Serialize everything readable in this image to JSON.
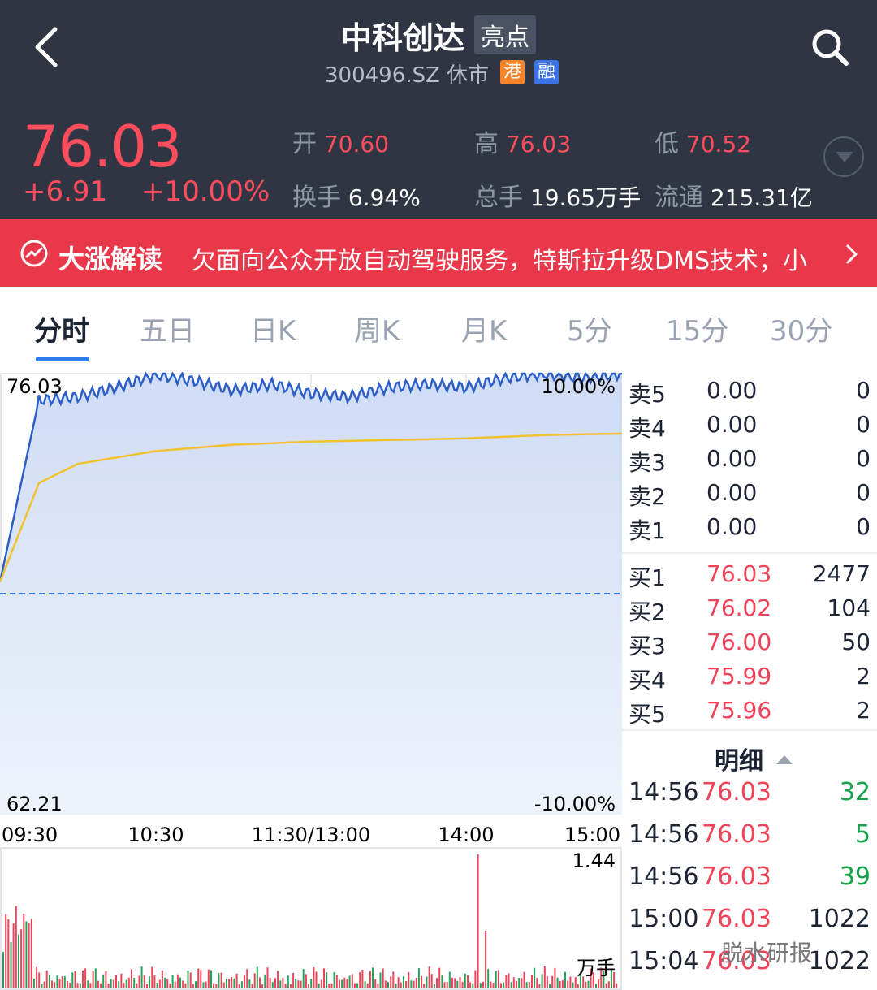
{
  "header": {
    "title": "中科创达",
    "title_tag": "亮点",
    "code_status": "300496.SZ 休市",
    "badge_hk": "港",
    "badge_margin": "融"
  },
  "quote": {
    "price": "76.03",
    "change": "+6.91",
    "change_pct": "+10.00%",
    "open_label": "开",
    "open": "70.60",
    "high_label": "高",
    "high": "76.03",
    "low_label": "低",
    "low": "70.52",
    "turnover_label": "换手",
    "turnover": "6.94%",
    "volume_label": "总手",
    "volume": "19.65万手",
    "float_label": "流通",
    "float_cap": "215.31亿"
  },
  "banner": {
    "label": "大涨解读",
    "text": "欠面向公众开放自动驾驶服务，特斯拉升级DMS技术；小"
  },
  "tabs": [
    "分时",
    "五日",
    "日K",
    "周K",
    "月K",
    "5分",
    "15分",
    "30分"
  ],
  "chart": {
    "price_top": "76.03",
    "price_bottom": "62.21",
    "pct_top": "10.00%",
    "pct_bottom": "-10.00%",
    "times": [
      "09:30",
      "10:30",
      "11:30/13:00",
      "14:00",
      "15:00"
    ],
    "vol_max": "1.44",
    "vol_unit": "万手"
  },
  "chart_data": {
    "type": "line",
    "x": [
      "09:30",
      "09:45",
      "10:00",
      "10:15",
      "10:30",
      "10:45",
      "11:00",
      "11:15",
      "11:30/13:00",
      "13:15",
      "13:30",
      "13:45",
      "14:00",
      "14:15",
      "14:30",
      "14:45",
      "15:00"
    ],
    "series": [
      {
        "values": [
          69.5,
          75.2,
          75.3,
          75.6,
          76.0,
          75.8,
          75.5,
          75.7,
          75.4,
          75.3,
          75.6,
          75.7,
          75.6,
          75.9,
          76.03,
          75.9,
          76.03
        ]
      },
      {
        "values": [
          69.5,
          72.6,
          73.2,
          73.4,
          73.6,
          73.7,
          73.8,
          73.85,
          73.9,
          73.92,
          73.95,
          73.97,
          74.0,
          74.05,
          74.1,
          74.13,
          74.15
        ]
      }
    ],
    "ylim": [
      62.21,
      76.03
    ],
    "ref_line": 69.12
  },
  "book": {
    "sells": [
      {
        "label": "卖5",
        "price": "0.00",
        "qty": "0"
      },
      {
        "label": "卖4",
        "price": "0.00",
        "qty": "0"
      },
      {
        "label": "卖3",
        "price": "0.00",
        "qty": "0"
      },
      {
        "label": "卖2",
        "price": "0.00",
        "qty": "0"
      },
      {
        "label": "卖1",
        "price": "0.00",
        "qty": "0"
      }
    ],
    "buys": [
      {
        "label": "买1",
        "price": "76.03",
        "qty": "2477"
      },
      {
        "label": "买2",
        "price": "76.02",
        "qty": "104"
      },
      {
        "label": "买3",
        "price": "76.00",
        "qty": "50"
      },
      {
        "label": "买4",
        "price": "75.99",
        "qty": "2"
      },
      {
        "label": "买5",
        "price": "75.96",
        "qty": "2"
      }
    ],
    "detail_label": "明细",
    "trades": [
      {
        "time": "14:56",
        "price": "76.03",
        "qty": "32"
      },
      {
        "time": "14:56",
        "price": "76.03",
        "qty": "5"
      },
      {
        "time": "14:56",
        "price": "76.03",
        "qty": "39"
      },
      {
        "time": "15:00",
        "price": "76.03",
        "qty": "1022"
      },
      {
        "time": "15:04",
        "price": "76.03",
        "qty": "1022"
      }
    ]
  },
  "watermark": "脱水研报",
  "colors": {
    "up": "#f04258",
    "header_bg": "#2f3542",
    "banner_bg": "#e8384a",
    "price_line": "#2b5fc7",
    "avg_line": "#f2c12e"
  }
}
